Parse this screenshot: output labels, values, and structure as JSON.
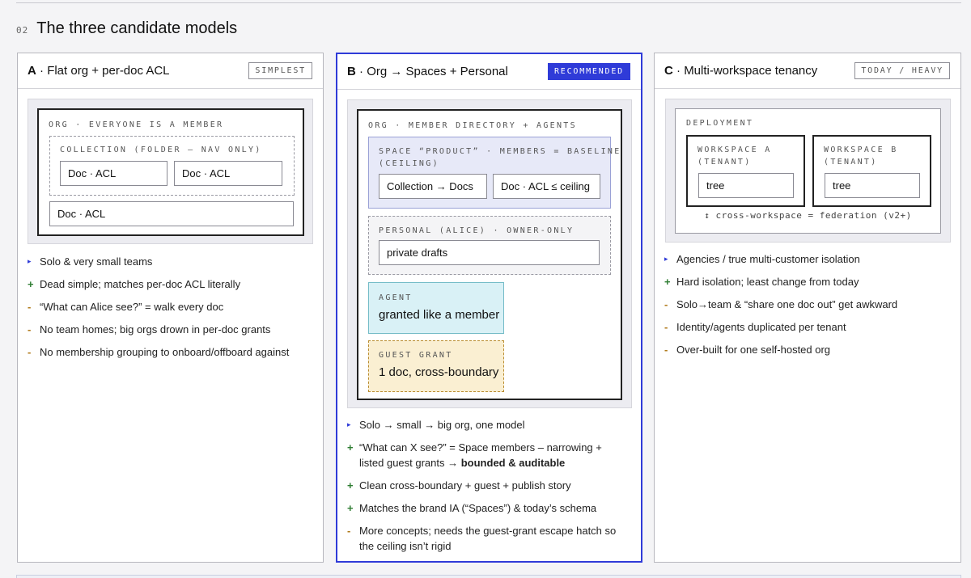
{
  "section": {
    "number": "02",
    "title": "The three candidate models"
  },
  "cards": {
    "a": {
      "letter": "A",
      "name": "Flat org + per-doc ACL",
      "badge": "SIMPLEST",
      "diagram": {
        "org_label": "ORG · EVERYONE IS A MEMBER",
        "collection_label": "COLLECTION (FOLDER — NAV ONLY)",
        "docs": [
          "Doc · ACL",
          "Doc · ACL",
          "Doc · ACL"
        ]
      },
      "bullets": [
        {
          "type": "neutral",
          "marker": "▸",
          "text": "Solo & very small teams"
        },
        {
          "type": "plus",
          "marker": "+",
          "text": "Dead simple; matches per-doc ACL literally"
        },
        {
          "type": "minus",
          "marker": "-",
          "text": "“What can Alice see?” = walk every doc"
        },
        {
          "type": "minus",
          "marker": "-",
          "text": "No team homes; big orgs drown in per-doc grants"
        },
        {
          "type": "minus",
          "marker": "-",
          "text": "No membership grouping to onboard/offboard against"
        }
      ]
    },
    "b": {
      "letter": "B",
      "name": "Org → Spaces + Personal",
      "badge": "RECOMMENDED",
      "diagram": {
        "org_label": "ORG · MEMBER DIRECTORY + AGENTS",
        "space_label_1": "SPACE “PRODUCT” · MEMBERS = BASELINE",
        "space_label_2": "(CEILING)",
        "space_items": [
          "Collection → Docs",
          "Doc · ACL ≤ ceiling"
        ],
        "personal_label": "PERSONAL (ALICE) · OWNER-ONLY",
        "personal_item": "private drafts",
        "agent_label": "AGENT",
        "agent_text": "granted like a member",
        "guest_label": "GUEST GRANT",
        "guest_text": "1 doc, cross-boundary"
      },
      "bullets": [
        {
          "type": "neutral",
          "marker": "▸",
          "text": "Solo → small → big org, one model"
        },
        {
          "type": "plus",
          "marker": "+",
          "text": "“What can X see?” = Space members – narrowing + listed guest grants → ",
          "bold": "bounded & auditable"
        },
        {
          "type": "plus",
          "marker": "+",
          "text": "Clean cross-boundary + guest + publish story"
        },
        {
          "type": "plus",
          "marker": "+",
          "text": "Matches the brand IA (“Spaces”) & today’s schema"
        },
        {
          "type": "minus",
          "marker": "-",
          "text": "More concepts; needs the guest-grant escape hatch so the ceiling isn’t rigid"
        }
      ]
    },
    "c": {
      "letter": "C",
      "name": "Multi-workspace tenancy",
      "badge": "TODAY / HEAVY",
      "diagram": {
        "deployment_label": "DEPLOYMENT",
        "ws_a_label_1": "WORKSPACE A",
        "ws_a_label_2": "(TENANT)",
        "ws_a_item": "tree",
        "ws_b_label_1": "WORKSPACE B",
        "ws_b_label_2": "(TENANT)",
        "ws_b_item": "tree",
        "federation": "↕ cross-workspace = federation (v2+)"
      },
      "bullets": [
        {
          "type": "neutral",
          "marker": "▸",
          "text": "Agencies / true multi-customer isolation"
        },
        {
          "type": "plus",
          "marker": "+",
          "text": "Hard isolation; least change from today"
        },
        {
          "type": "minus",
          "marker": "-",
          "text": "Solo→team & “share one doc out” get awkward"
        },
        {
          "type": "minus",
          "marker": "-",
          "text": "Identity/agents duplicated per tenant"
        },
        {
          "type": "minus",
          "marker": "-",
          "text": "Over-built for one self-hosted org"
        }
      ]
    }
  },
  "colors": {
    "accent": "#2f3bd8",
    "plus": "#2e7d32",
    "minus": "#b07a1a",
    "space_fill": "#e7e9f8",
    "agent_fill": "#d9f1f6",
    "guest_fill": "#faefd2"
  }
}
